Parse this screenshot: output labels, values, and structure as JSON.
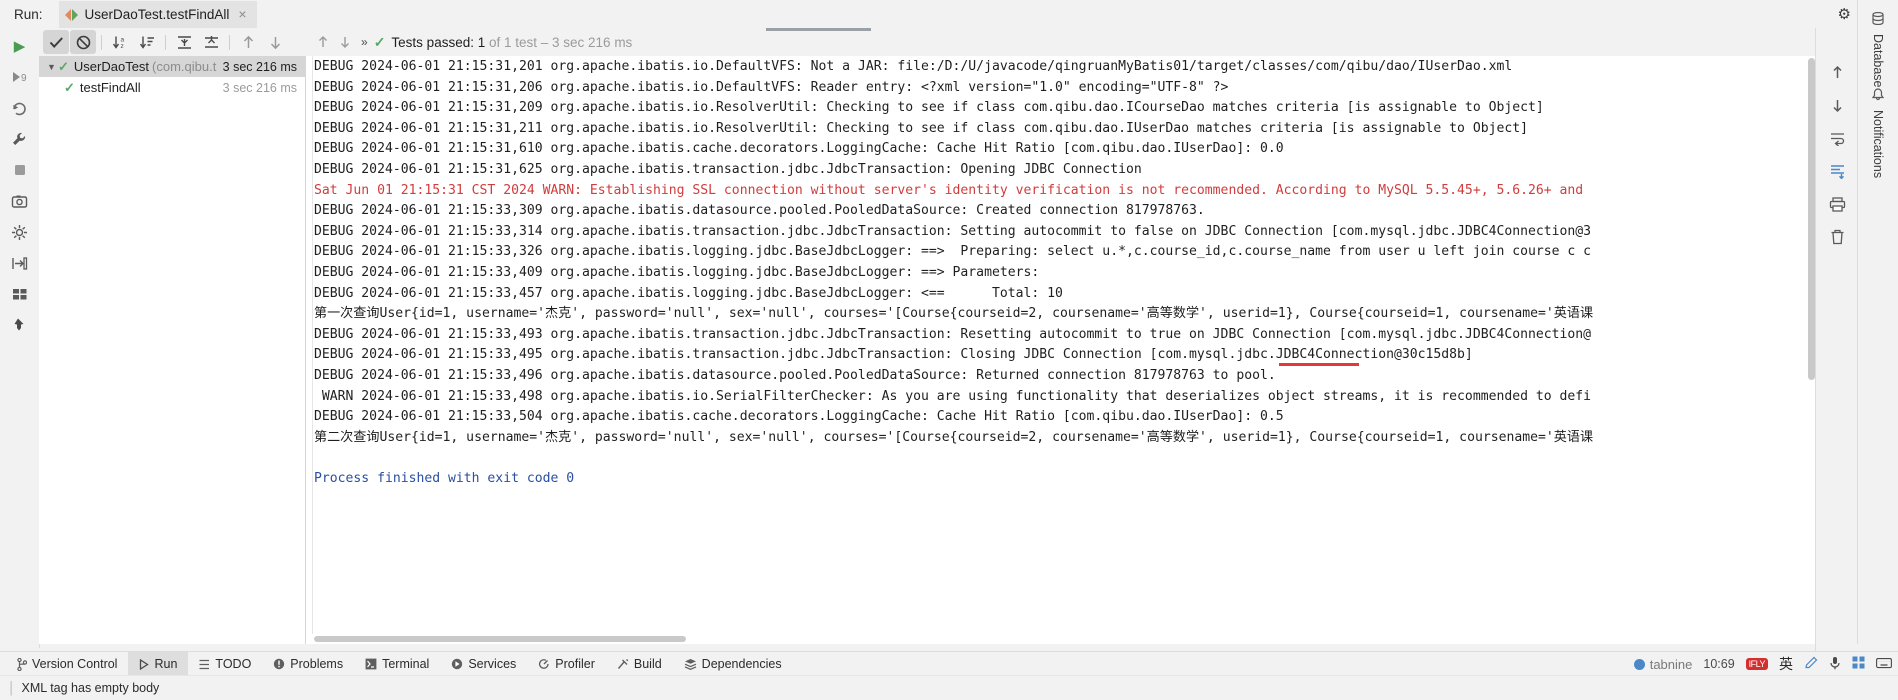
{
  "runbar": {
    "label": "Run:",
    "tab_title": "UserDaoTest.testFindAll",
    "close": "×",
    "settings_icon": "gear-icon",
    "minimize": "—",
    "maximize": "□"
  },
  "left_toolbar": {
    "items": [
      {
        "name": "rerun-button",
        "glyph": "▶"
      },
      {
        "name": "rerun-failed-tests-button",
        "glyph": "▶9"
      },
      {
        "name": "rerun-automatically-button",
        "glyph": "↻"
      },
      {
        "name": "toggle-auto-test-button",
        "glyph": "⚒"
      },
      {
        "name": "stop-button",
        "glyph": "■"
      },
      {
        "name": "screenshot-button",
        "glyph": "▣"
      },
      {
        "name": "profiler-button",
        "glyph": "⚙"
      },
      {
        "name": "export-test-results-button",
        "glyph": "⇥"
      },
      {
        "name": "layout-button",
        "glyph": "▦"
      },
      {
        "name": "pin-tab-button",
        "glyph": "✒"
      }
    ]
  },
  "tree_toolbar": {
    "items": [
      {
        "name": "show-passed-toggle",
        "glyph": "✔",
        "pressed": true
      },
      {
        "name": "show-ignored-toggle",
        "glyph": "⊘",
        "pressed": true
      },
      {
        "name": "sort-alphabetically-button",
        "glyph": "↓a̲z"
      },
      {
        "name": "sort-by-duration-button",
        "glyph": "↓≡"
      },
      {
        "name": "expand-all-button",
        "glyph": "⇲"
      },
      {
        "name": "collapse-all-button",
        "glyph": "⇱"
      },
      {
        "name": "previous-failed-test-button",
        "glyph": "↑"
      },
      {
        "name": "next-failed-test-button",
        "glyph": "↓"
      }
    ]
  },
  "tree": {
    "rows": [
      {
        "name": "tree-row-userdaotest",
        "expanded": true,
        "selected": true,
        "label": "UserDaoTest",
        "package": "(com.qibu.t",
        "time": "3 sec 216 ms",
        "time_dim": false,
        "indent": 0
      },
      {
        "name": "tree-row-testfindall",
        "expanded": false,
        "selected": false,
        "label": "testFindAll",
        "package": "",
        "time": "3 sec 216 ms",
        "time_dim": true,
        "indent": 1
      }
    ]
  },
  "console_header": {
    "icons": [
      "expand-icon",
      "collapse-icon"
    ],
    "chevrons": "»",
    "status_prefix": "Tests passed: ",
    "status_count": "1",
    "status_suffix": " of 1 test – 3 sec 216 ms"
  },
  "console": {
    "lines": [
      {
        "type": "debug",
        "text": "DEBUG 2024-06-01 21:15:31,201 org.apache.ibatis.io.DefaultVFS: Not a JAR: file:/D:/U/javacode/qingruanMyBatis01/target/classes/com/qibu/dao/IUserDao.xml"
      },
      {
        "type": "debug",
        "text": "DEBUG 2024-06-01 21:15:31,206 org.apache.ibatis.io.DefaultVFS: Reader entry: <?xml version=\"1.0\" encoding=\"UTF-8\" ?>"
      },
      {
        "type": "debug",
        "text": "DEBUG 2024-06-01 21:15:31,209 org.apache.ibatis.io.ResolverUtil: Checking to see if class com.qibu.dao.ICourseDao matches criteria [is assignable to Object]"
      },
      {
        "type": "debug",
        "text": "DEBUG 2024-06-01 21:15:31,211 org.apache.ibatis.io.ResolverUtil: Checking to see if class com.qibu.dao.IUserDao matches criteria [is assignable to Object]"
      },
      {
        "type": "debug",
        "text": "DEBUG 2024-06-01 21:15:31,610 org.apache.ibatis.cache.decorators.LoggingCache: Cache Hit Ratio [com.qibu.dao.IUserDao]: 0.0"
      },
      {
        "type": "debug",
        "text": "DEBUG 2024-06-01 21:15:31,625 org.apache.ibatis.transaction.jdbc.JdbcTransaction: Opening JDBC Connection"
      },
      {
        "type": "warn",
        "text": "Sat Jun 01 21:15:31 CST 2024 WARN: Establishing SSL connection without server's identity verification is not recommended. According to MySQL 5.5.45+, 5.6.26+ and"
      },
      {
        "type": "debug",
        "text": "DEBUG 2024-06-01 21:15:33,309 org.apache.ibatis.datasource.pooled.PooledDataSource: Created connection 817978763."
      },
      {
        "type": "debug",
        "text": "DEBUG 2024-06-01 21:15:33,314 org.apache.ibatis.transaction.jdbc.JdbcTransaction: Setting autocommit to false on JDBC Connection [com.mysql.jdbc.JDBC4Connection@3"
      },
      {
        "type": "debug",
        "text": "DEBUG 2024-06-01 21:15:33,326 org.apache.ibatis.logging.jdbc.BaseJdbcLogger: ==>  Preparing: select u.*,c.course_id,c.course_name from user u left join course c c"
      },
      {
        "type": "debug",
        "text": "DEBUG 2024-06-01 21:15:33,409 org.apache.ibatis.logging.jdbc.BaseJdbcLogger: ==> Parameters:"
      },
      {
        "type": "debug",
        "text": "DEBUG 2024-06-01 21:15:33,457 org.apache.ibatis.logging.jdbc.BaseJdbcLogger: <==      Total: 10"
      },
      {
        "type": "debug",
        "text": "第一次查询User{id=1, username='杰克', password='null', sex='null', courses='[Course{courseid=2, coursename='高等数学', userid=1}, Course{courseid=1, coursename='英语课"
      },
      {
        "type": "debug",
        "text": "DEBUG 2024-06-01 21:15:33,493 org.apache.ibatis.transaction.jdbc.JdbcTransaction: Resetting autocommit to true on JDBC Connection [com.mysql.jdbc.JDBC4Connection@"
      },
      {
        "type": "debug",
        "text": "DEBUG 2024-06-01 21:15:33,495 org.apache.ibatis.transaction.jdbc.JdbcTransaction: Closing JDBC Connection [com.mysql.jdbc.JDBC4Connection@30c15d8b]"
      },
      {
        "type": "debug",
        "text": "DEBUG 2024-06-01 21:15:33,496 org.apache.ibatis.datasource.pooled.PooledDataSource: Returned connection 817978763 to pool."
      },
      {
        "type": "debug",
        "text": " WARN 2024-06-01 21:15:33,498 org.apache.ibatis.io.SerialFilterChecker: As you are using functionality that deserializes object streams, it is recommended to defi"
      },
      {
        "type": "debug",
        "text": "DEBUG 2024-06-01 21:15:33,504 org.apache.ibatis.cache.decorators.LoggingCache: Cache Hit Ratio [com.qibu.dao.IUserDao]: 0.5"
      },
      {
        "type": "debug",
        "text": "第二次查询User{id=1, username='杰克', password='null', sex='null', courses='[Course{courseid=2, coursename='高等数学', userid=1}, Course{courseid=1, coursename='英语课"
      },
      {
        "type": "blank",
        "text": ""
      },
      {
        "type": "exit",
        "text": "Process finished with exit code 0"
      }
    ],
    "highlight_color": "#e03a3a"
  },
  "right_rail": {
    "items": [
      {
        "name": "scroll-up-icon",
        "glyph": "↑"
      },
      {
        "name": "scroll-down-icon",
        "glyph": "↓"
      },
      {
        "name": "soft-wrap-icon",
        "glyph": "↩"
      },
      {
        "name": "scroll-to-end-icon",
        "glyph": "↧",
        "accent": true
      },
      {
        "name": "print-icon",
        "glyph": "⎙"
      },
      {
        "name": "clear-all-icon",
        "glyph": "🗑"
      }
    ]
  },
  "right_tabs": [
    {
      "name": "tool-tab-database",
      "label": "Database",
      "icon": "database-icon"
    },
    {
      "name": "tool-tab-notifications",
      "label": "Notifications",
      "icon": "bell-icon"
    }
  ],
  "bottom_tabs": [
    {
      "name": "tool-tab-version-control",
      "label": "Version Control",
      "icon": "branch-icon",
      "active": false
    },
    {
      "name": "tool-tab-run",
      "label": "Run",
      "icon": "play-icon",
      "active": true
    },
    {
      "name": "tool-tab-todo",
      "label": "TODO",
      "icon": "list-icon",
      "active": false
    },
    {
      "name": "tool-tab-problems",
      "label": "Problems",
      "icon": "warning-icon",
      "active": false
    },
    {
      "name": "tool-tab-terminal",
      "label": "Terminal",
      "icon": "terminal-icon",
      "active": false
    },
    {
      "name": "tool-tab-services",
      "label": "Services",
      "icon": "services-icon",
      "active": false
    },
    {
      "name": "tool-tab-profiler",
      "label": "Profiler",
      "icon": "profiler-icon",
      "active": false
    },
    {
      "name": "tool-tab-build",
      "label": "Build",
      "icon": "hammer-icon",
      "active": false
    },
    {
      "name": "tool-tab-dependencies",
      "label": "Dependencies",
      "icon": "layers-icon",
      "active": false
    }
  ],
  "tray": {
    "tabnine_label": "tabnine",
    "clock": "10:69",
    "ime_label": "IFLY",
    "ime_mode": "英",
    "icons": [
      "pencil-icon",
      "microphone-icon",
      "grid-icon",
      "keyboard-icon"
    ]
  },
  "statusbar": {
    "message": "XML tag has empty body"
  }
}
